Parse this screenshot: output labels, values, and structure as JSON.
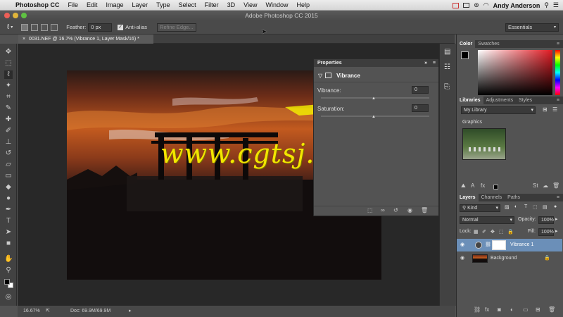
{
  "menubar": {
    "app_name": "Photoshop CC",
    "items": [
      "File",
      "Edit",
      "Image",
      "Layer",
      "Type",
      "Select",
      "Filter",
      "3D",
      "View",
      "Window",
      "Help"
    ],
    "user": "Andy Anderson"
  },
  "window": {
    "title": "Adobe Photoshop CC 2015"
  },
  "options": {
    "feather_label": "Feather:",
    "feather_value": "0 px",
    "antialias_label": "Anti-alias",
    "antialias_checked": true,
    "refine_edge": "Refine Edge...",
    "workspace": "Essentials"
  },
  "document": {
    "tab_title": "0031.NEF @ 16.7% (Vibrance 1, Layer Mask/16) *"
  },
  "status": {
    "zoom": "16.67%",
    "doc_info": "Doc: 69.9M/69.9M"
  },
  "properties": {
    "title": "Properties",
    "adjustment": "Vibrance",
    "vibrance_label": "Vibrance:",
    "vibrance_value": "0",
    "saturation_label": "Saturation:",
    "saturation_value": "0"
  },
  "color_panel": {
    "tabs": [
      "Color",
      "Swatches"
    ]
  },
  "libraries": {
    "tabs": [
      "Libraries",
      "Adjustments",
      "Styles"
    ],
    "library": "My Library",
    "section": "Graphics"
  },
  "layers_panel": {
    "tabs": [
      "Layers",
      "Channels",
      "Paths"
    ],
    "filter": "Kind",
    "blend_mode": "Normal",
    "opacity_label": "Opacity:",
    "opacity": "100%",
    "lock_label": "Lock:",
    "fill_label": "Fill:",
    "fill": "100%",
    "layers": [
      {
        "name": "Vibrance 1",
        "selected": true
      },
      {
        "name": "Background",
        "selected": false
      }
    ]
  },
  "watermark": "www.cgtsj.com",
  "colors": {
    "accent_highlight": "#6b8fb8",
    "watermark": "#f3e600"
  }
}
